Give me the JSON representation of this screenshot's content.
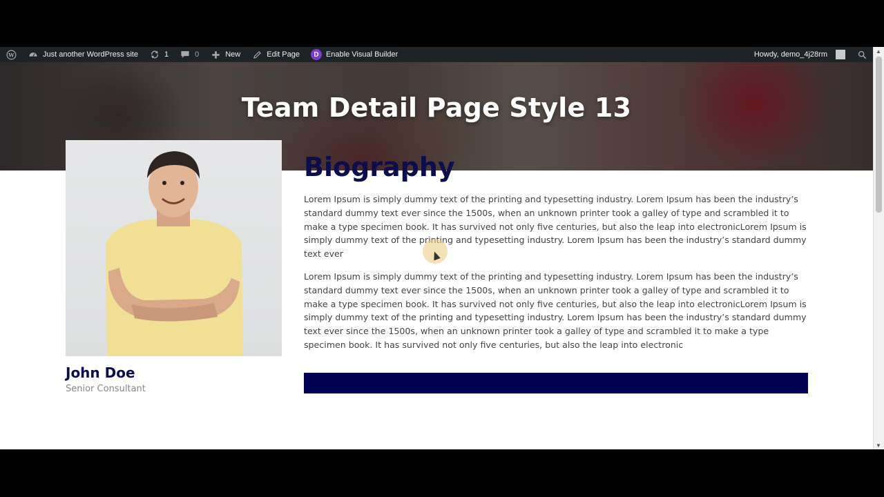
{
  "adminbar": {
    "site_name": "Just another WordPress site",
    "updates_count": "1",
    "comments_count": "0",
    "new_label": "New",
    "edit_page_label": "Edit Page",
    "visual_builder_label": "Enable Visual Builder",
    "divi_letter": "D",
    "howdy_label": "Howdy, demo_4j28rm"
  },
  "hero": {
    "title": "Team Detail Page Style 13"
  },
  "member": {
    "name": "John Doe",
    "role": "Senior Consultant"
  },
  "biography": {
    "heading": "Biography",
    "paragraphs": [
      "Lorem Ipsum is simply dummy text of the printing and typesetting industry. Lorem Ipsum has been the industry’s standard dummy text ever since the 1500s, when an unknown printer took a galley of type and scrambled it to make a type specimen book. It has survived not only five centuries, but also the leap into electronicLorem Ipsum is simply dummy text of the printing and typesetting industry. Lorem Ipsum has been the industry’s standard dummy text ever",
      "Lorem Ipsum is simply dummy text of the printing and typesetting industry. Lorem Ipsum has been the industry’s standard dummy text ever since the 1500s, when an unknown printer took a galley of type and scrambled it to make a type specimen book. It has survived not only five centuries, but also the leap into electronicLorem Ipsum is simply dummy text of the printing and typesetting industry. Lorem Ipsum has been the industry’s standard dummy text ever since the 1500s, when an unknown printer took a galley of type and scrambled it to make a type specimen book. It has survived not only five centuries, but also the leap into electronic"
    ]
  },
  "colors": {
    "heading_navy": "#0d0d4b",
    "cta_navy": "#000055",
    "adminbar_bg": "#1d2327",
    "divi_purple": "#7e3bd0"
  }
}
